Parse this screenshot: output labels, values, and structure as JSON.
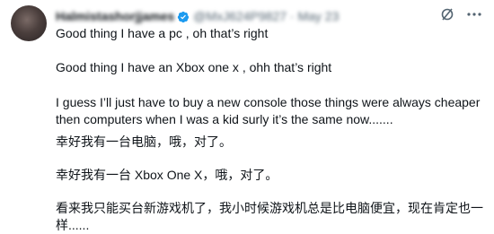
{
  "tweet": {
    "author": {
      "display_name": "Halmistashorjjames",
      "handle_and_date": "@MxJ624P9827 · May 23"
    },
    "paragraphs": [
      "Good thing I have a pc , oh that’s right",
      "Good thing I have an Xbox one x , ohh that’s right",
      "I guess I’ll just have to buy a new console those things were always cheaper then computers when I was a kid surly it’s the same now.......",
      "幸好我有一台电脑，哦，对了。",
      "幸好我有一台 Xbox One X，哦，对了。",
      "看来我只能买台新游戏机了，我小时候游戏机总是比电脑便宜，现在肯定也一样......"
    ]
  },
  "icons": {
    "verified": "verified-badge-icon",
    "grok": "grok-slash-icon",
    "more": "more-dots-icon"
  },
  "colors": {
    "verified_blue": "#1d9bf0",
    "secondary_text": "#536471",
    "primary_text": "#0f1419"
  }
}
